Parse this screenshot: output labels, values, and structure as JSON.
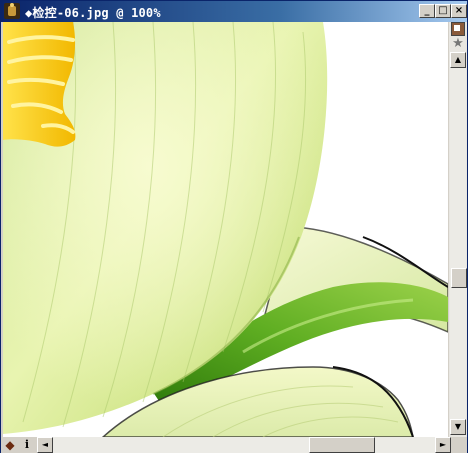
{
  "window": {
    "title": "◆检控-06.jpg @ 100%"
  },
  "title_buttons": {
    "minimize": "_",
    "maximize": "□",
    "close": "×"
  },
  "scrollbars": {
    "up": "▲",
    "down": "▼",
    "left": "◄",
    "right": "►"
  },
  "icons": {
    "app": "image-document-icon",
    "swatch": "color-swatch-icon",
    "star": "star-icon",
    "navigator": "navigator-icon",
    "info": "i"
  },
  "colors": {
    "titlebar_start": "#0a246a",
    "titlebar_end": "#a6caf0",
    "petal_light": "#f4f8c0",
    "petal_green": "#b8d86a",
    "leaf_green": "#3e8a12",
    "stamen_yellow": "#ffd21a"
  }
}
